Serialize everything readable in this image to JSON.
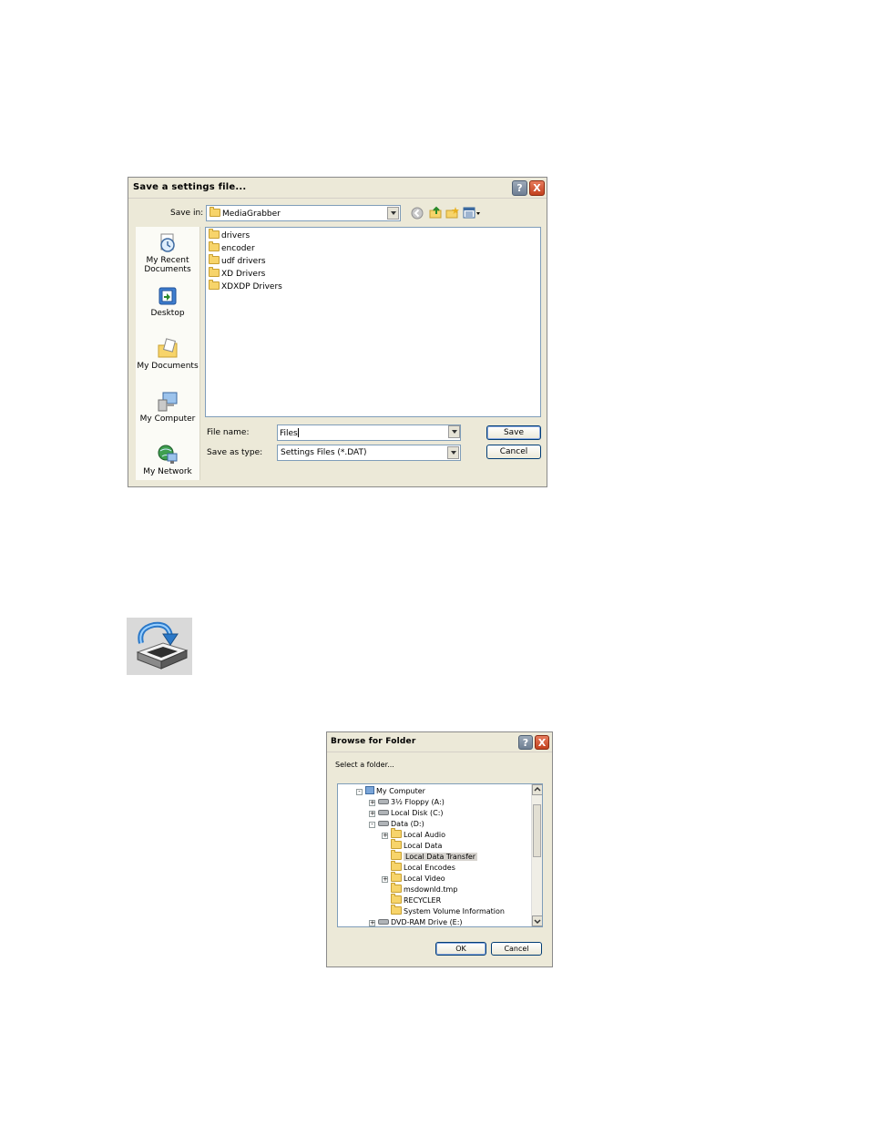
{
  "save_dialog": {
    "title": "Save a settings file...",
    "help_label": "?",
    "close_label": "X",
    "save_in_label": "Save in:",
    "save_in_value": "MediaGrabber",
    "places": [
      {
        "label": "My Recent Documents",
        "icon": "recent-documents-icon"
      },
      {
        "label": "Desktop",
        "icon": "desktop-icon"
      },
      {
        "label": "My Documents",
        "icon": "my-documents-icon"
      },
      {
        "label": "My Computer",
        "icon": "my-computer-icon"
      },
      {
        "label": "My Network",
        "icon": "my-network-icon"
      }
    ],
    "files": [
      "drivers",
      "encoder",
      "udf drivers",
      "XD Drivers",
      "XDXDP Drivers"
    ],
    "file_name_label": "File name:",
    "file_name_value": "Files",
    "save_as_type_label": "Save as type:",
    "save_as_type_value": "Settings Files (*.DAT)",
    "save_button": "Save",
    "cancel_button": "Cancel"
  },
  "browse_dialog": {
    "title": "Browse for Folder",
    "help_label": "?",
    "close_label": "X",
    "prompt": "Select a folder...",
    "tree": [
      {
        "label": "My Computer",
        "expander": "-"
      },
      {
        "label": "3½ Floppy (A:)",
        "expander": "+"
      },
      {
        "label": "Local Disk (C:)",
        "expander": "+"
      },
      {
        "label": "Data (D:)",
        "expander": "-"
      },
      {
        "label": "Local Audio",
        "expander": "+"
      },
      {
        "label": "Local Data",
        "expander": ""
      },
      {
        "label": "Local Data Transfer",
        "expander": "",
        "selected": true
      },
      {
        "label": "Local Encodes",
        "expander": ""
      },
      {
        "label": "Local Video",
        "expander": "+"
      },
      {
        "label": "msdownld.tmp",
        "expander": ""
      },
      {
        "label": "RECYCLER",
        "expander": ""
      },
      {
        "label": "System Volume Information",
        "expander": ""
      },
      {
        "label": "DVD-RAM Drive (E:)",
        "expander": "+"
      }
    ],
    "ok_button": "OK",
    "cancel_button": "Cancel"
  },
  "colors": {
    "dialog_bg": "#ece9d8",
    "selection": "#d6d3ce",
    "folder": "#f7d46a"
  }
}
